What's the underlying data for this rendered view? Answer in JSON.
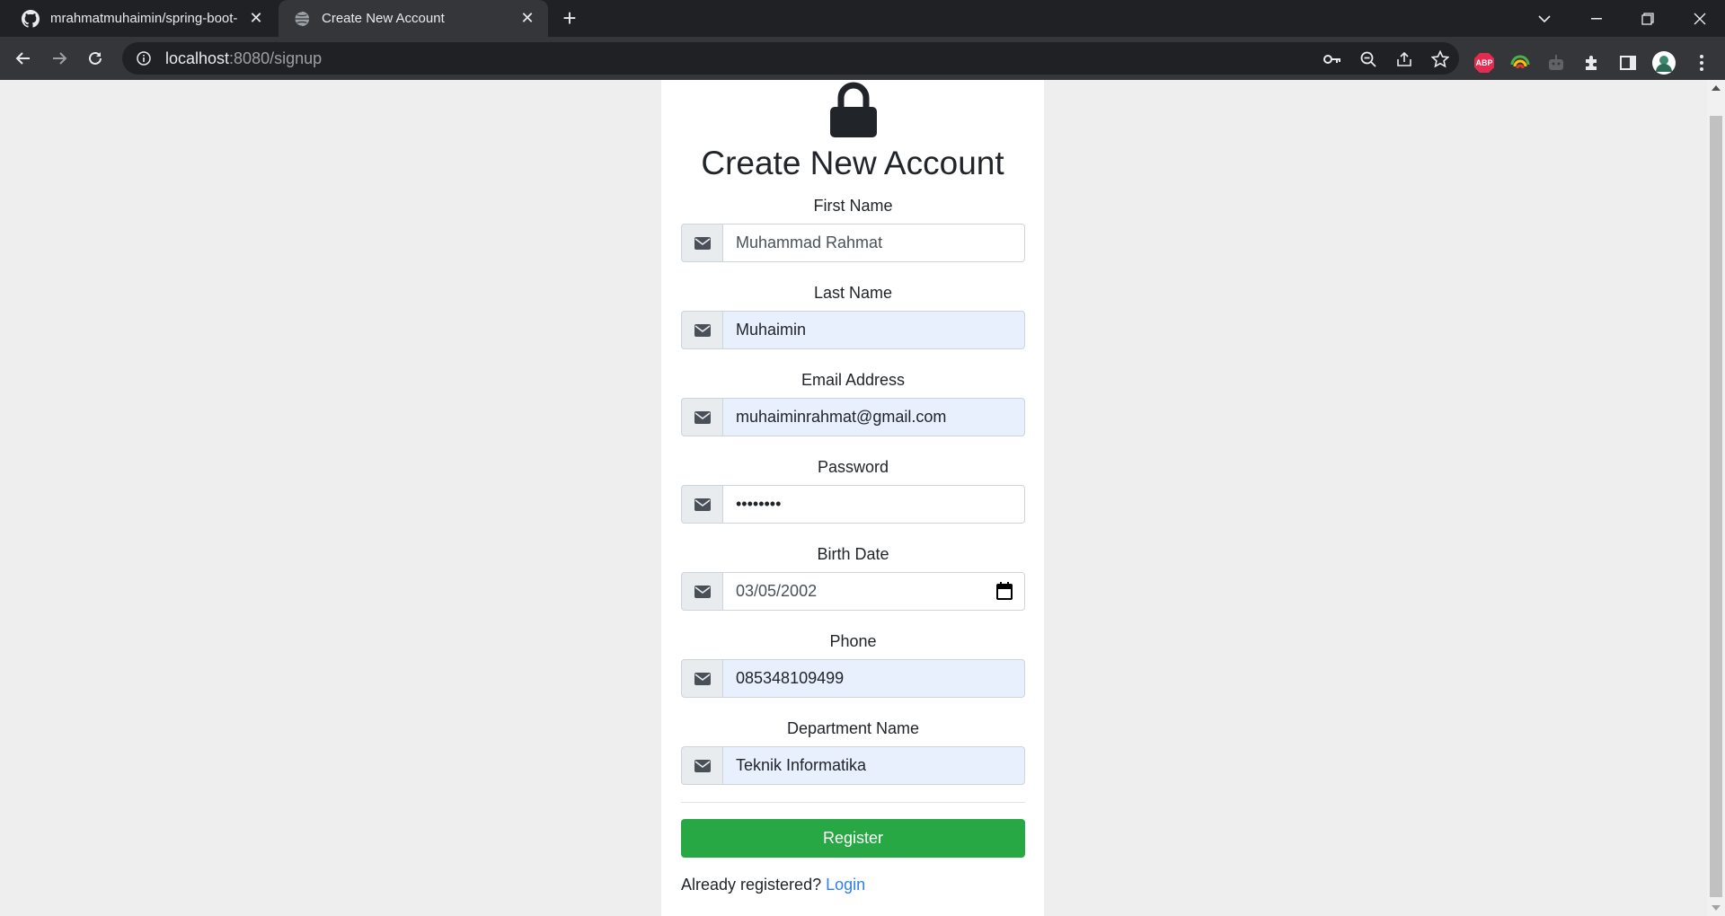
{
  "browser": {
    "tabs": [
      {
        "title": "mrahmatmuhaimin/spring-boot-",
        "favicon": "github-icon",
        "active": false
      },
      {
        "title": "Create New Account",
        "favicon": "globe-icon",
        "active": true
      }
    ],
    "new_tab_label": "+",
    "url_host": "localhost",
    "url_path": ":8080/signup",
    "extensions": [
      "key-icon",
      "zoom-out-icon",
      "share-icon",
      "star-icon",
      "adblock-plus-icon",
      "color-extension-icon",
      "robot-extension-icon",
      "puzzle-icon",
      "side-panel-icon",
      "profile-avatar",
      "more-vert-icon"
    ],
    "adblock_label": "ABP"
  },
  "form": {
    "title": "Create New Account",
    "icon": "lock-icon",
    "fields": [
      {
        "label": "First Name",
        "value": "Muhammad Rahmat",
        "type": "text",
        "style": "plain-muted",
        "icon": "envelope-icon"
      },
      {
        "label": "Last Name",
        "value": "Muhaimin",
        "type": "text",
        "style": "autofill",
        "icon": "envelope-icon"
      },
      {
        "label": "Email Address",
        "value": "muhaiminrahmat@gmail.com",
        "type": "email",
        "style": "autofill",
        "icon": "envelope-icon"
      },
      {
        "label": "Password",
        "value": "••••••••",
        "type": "password",
        "style": "plain",
        "icon": "envelope-icon"
      },
      {
        "label": "Birth Date",
        "value": "03/05/2002",
        "type": "date",
        "style": "plain-muted",
        "icon": "envelope-icon"
      },
      {
        "label": "Phone",
        "value": "085348109499",
        "type": "text",
        "style": "autofill",
        "icon": "envelope-icon"
      },
      {
        "label": "Department Name",
        "value": "Teknik Informatika",
        "type": "text",
        "style": "autofill",
        "icon": "envelope-icon"
      }
    ],
    "register_label": "Register",
    "already_text": "Already registered?",
    "login_label": "Login"
  },
  "colors": {
    "register_button": "#28a745",
    "link": "#2f80ed",
    "autofill_bg": "#e8f0fe",
    "chrome_dark": "#202124",
    "chrome_toolbar": "#35363a"
  }
}
